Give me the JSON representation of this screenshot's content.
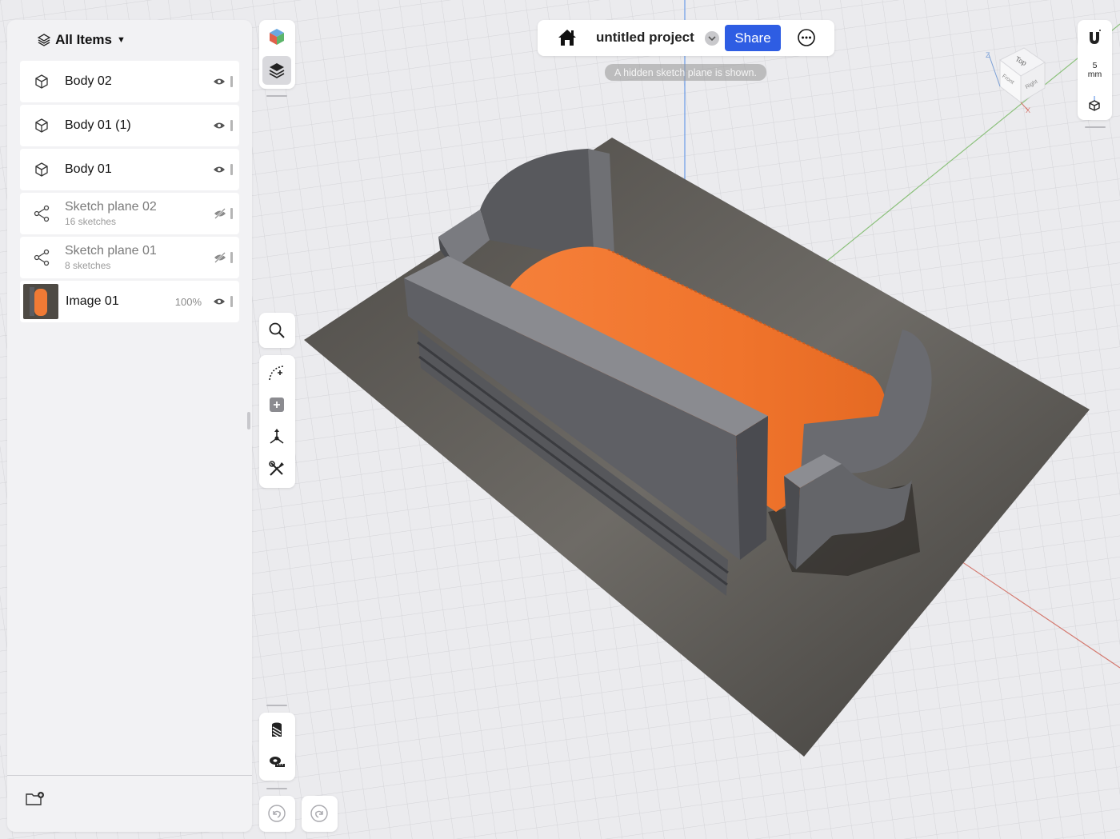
{
  "panel": {
    "header_label": "All Items",
    "items": [
      {
        "label": "Body 02",
        "sub": "",
        "kind": "body"
      },
      {
        "label": "Body 01 (1)",
        "sub": "",
        "kind": "body"
      },
      {
        "label": "Body 01",
        "sub": "",
        "kind": "body"
      },
      {
        "label": "Sketch plane 02",
        "sub": "16 sketches",
        "kind": "sketch"
      },
      {
        "label": "Sketch plane 01",
        "sub": "8 sketches",
        "kind": "sketch"
      },
      {
        "label": "Image 01",
        "sub": "",
        "kind": "image",
        "opacity": "100%"
      }
    ]
  },
  "topbar": {
    "project_title": "untitled project",
    "share_label": "Share"
  },
  "hint": "A hidden sketch plane is shown.",
  "grid_unit": {
    "value": "5",
    "unit": "mm"
  },
  "view_cube": {
    "top": "Top",
    "front": "Front",
    "right": "Right"
  },
  "axis_labels": {
    "z": "Z",
    "x": "X"
  },
  "colors": {
    "accent": "#2e5de3",
    "object_orange": "#f07a35",
    "object_gray": "#5a5b5f"
  }
}
